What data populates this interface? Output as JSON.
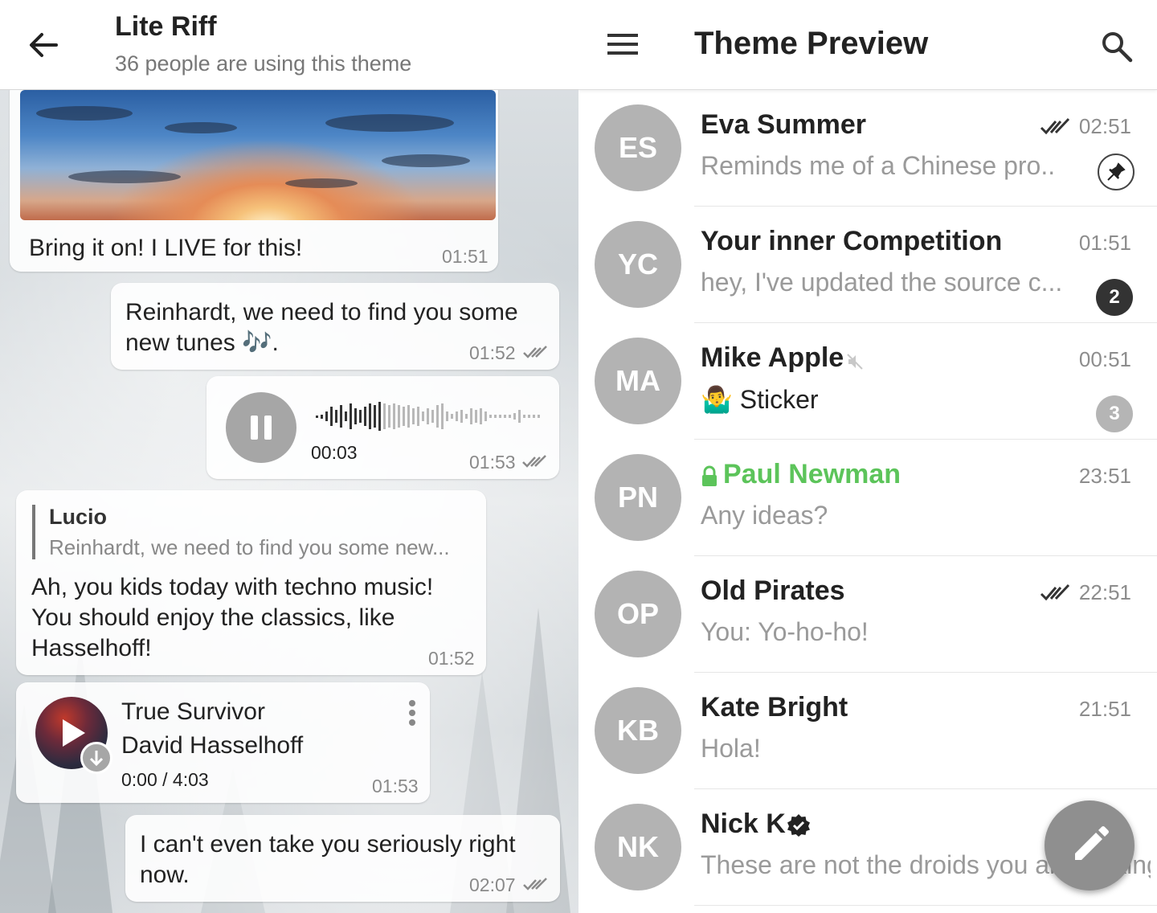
{
  "left": {
    "title": "Lite Riff",
    "subtitle": "36 people are using this theme",
    "messages": {
      "photo_caption": "Bring it on! I LIVE for this!",
      "photo_time": "01:51",
      "msg1_text": "Reinhardt, we need to find you some new tunes 🎶.",
      "msg1_time": "01:52",
      "voice_duration": "00:03",
      "voice_time": "01:53",
      "reply_author": "Lucio",
      "reply_quote": "Reinhardt, we need to find you some new...",
      "reply_text": "Ah, you kids today with techno music! You should enjoy the classics, like Hasselhoff!",
      "reply_time": "01:52",
      "music_title": "True Survivor",
      "music_artist": "David Hasselhoff",
      "music_progress": "0:00 / 4:03",
      "music_time": "01:53",
      "last_text": "I can't even take you seriously right now.",
      "last_time": "02:07"
    }
  },
  "right": {
    "title": "Theme Preview",
    "chats": [
      {
        "initials": "ES",
        "name": "Eva Summer",
        "preview": "Reminds me of a Chinese pro...",
        "time": "02:51"
      },
      {
        "initials": "YC",
        "name": "Your inner Competition",
        "preview": "hey, I've updated the source c...",
        "time": "01:51",
        "badge": "2"
      },
      {
        "initials": "MA",
        "name": "Mike Apple",
        "preview": "Sticker",
        "time": "00:51",
        "badge": "3"
      },
      {
        "initials": "PN",
        "name": "Paul Newman",
        "preview": "Any ideas?",
        "time": "23:51"
      },
      {
        "initials": "OP",
        "name": "Old Pirates",
        "preview": "You: Yo-ho-ho!",
        "time": "22:51"
      },
      {
        "initials": "KB",
        "name": "Kate Bright",
        "preview": "Hola!",
        "time": "21:51"
      },
      {
        "initials": "NK",
        "name": "Nick K",
        "preview": "These are not the droids you are looking for",
        "time": ""
      }
    ]
  },
  "colors": {
    "secret_chat_green": "#5cc45a",
    "badge_dark": "#333333",
    "badge_muted": "#b5b5b5",
    "avatar_gray": "#b3b3b3"
  },
  "icons": [
    "back-arrow-icon",
    "menu-icon",
    "search-icon",
    "pin-icon",
    "mute-icon",
    "lock-icon",
    "verified-icon",
    "pencil-icon",
    "pause-icon",
    "play-icon",
    "download-icon",
    "more-vert-icon",
    "double-check-icon"
  ]
}
